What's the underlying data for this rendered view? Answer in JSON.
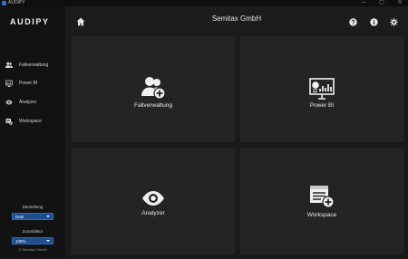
{
  "window": {
    "title": "AUDIPY",
    "controls": {
      "minimize": "—",
      "maximize": "▢",
      "close": "✕"
    }
  },
  "sidebar": {
    "logo": "AUDIPY",
    "items": [
      {
        "label": "Fallverwaltung",
        "icon": "users-icon"
      },
      {
        "label": "Power BI",
        "icon": "dashboard-icon"
      },
      {
        "label": "Analyzer",
        "icon": "eye-icon"
      },
      {
        "label": "Workspace",
        "icon": "workspace-icon"
      }
    ],
    "appearance": {
      "label": "Darstellung",
      "value": "Dark"
    },
    "zoom": {
      "label": "Zoomfaktor",
      "value": "100%"
    },
    "copyright": "© Semitax GmbH"
  },
  "header": {
    "company": "Semitax GmbH",
    "icons": [
      "home-icon",
      "help-icon",
      "info-icon",
      "settings-icon"
    ]
  },
  "tiles": [
    {
      "label": "Fallverwaltung",
      "icon": "users-add-icon"
    },
    {
      "label": "Power BI",
      "icon": "dashboard-icon"
    },
    {
      "label": "Analyzer",
      "icon": "eye-icon"
    },
    {
      "label": "Workspace",
      "icon": "workspace-add-icon"
    }
  ],
  "colors": {
    "accent": "#1d4e8f",
    "sidebar": "#121212",
    "header": "#1c1c1c",
    "tile": "#242424",
    "background": "#1a1a1a"
  }
}
